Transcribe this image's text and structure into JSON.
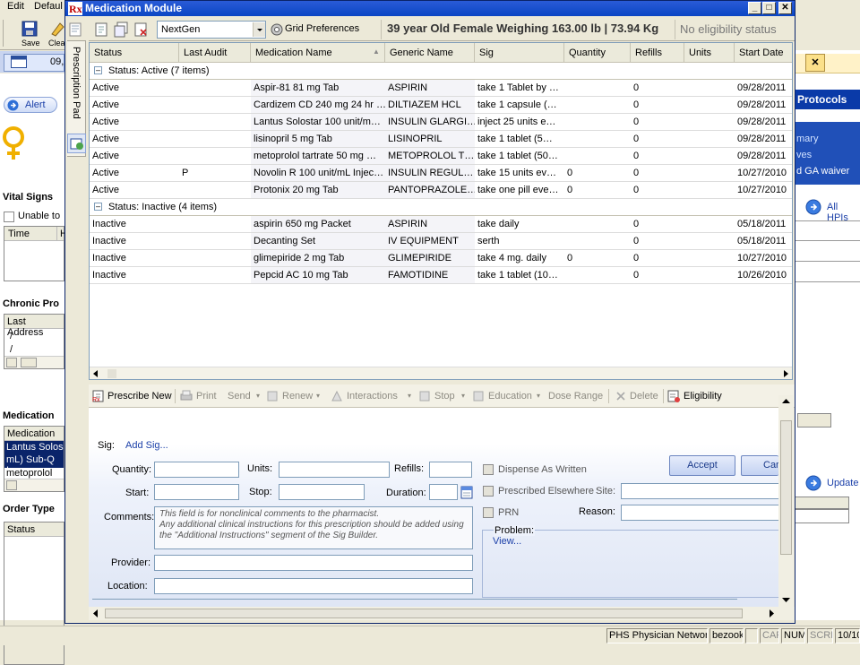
{
  "background_app": {
    "menu": [
      "Edit",
      "Defaul"
    ],
    "toolbar": {
      "save_label": "Save",
      "clear_label": "Clea"
    },
    "tab_fragment": "09,",
    "alert_button": "Alert",
    "vital_signs_label": "Vital Signs",
    "unable_label": "Unable to",
    "vitals_columns": [
      "Time",
      "H"
    ],
    "chronic_label": "Chronic Pro",
    "last_address_label": "Last Address",
    "slash_rows": [
      " / ",
      " / "
    ],
    "medication_label": "Medication",
    "medication_col": "Medication",
    "medication_rows": [
      "Lantus Solos",
      "mL) Sub-Q In",
      "metoprolol tar"
    ],
    "order_type_label": "Order Type",
    "order_status_col": "Status",
    "right_close": "✕",
    "right_protocols": "Protocols",
    "right_link1": "mary",
    "right_link2": "ves",
    "right_link3": "d GA waiver",
    "all_hpis_label": "All HPIs",
    "update_label": "Update"
  },
  "window": {
    "title": "Medication Module",
    "min_glyph": "_",
    "max_glyph": "□",
    "close_glyph": "✕"
  },
  "side_tab": {
    "label": "Prescription Pad"
  },
  "toolbar": {
    "source_select": "NextGen",
    "grid_preferences_label": "Grid Preferences",
    "patient_info": "39 year Old Female Weighing 163.00 lb  | 73.94 Kg",
    "eligibility_status": "No eligibility status"
  },
  "grid": {
    "columns": [
      "Status",
      "Last Audit",
      "Medication Name",
      "Generic Name",
      "Sig",
      "Quantity",
      "Refills",
      "Units",
      "Start Date"
    ],
    "sort_indicator": "▲",
    "groups": [
      {
        "label": "Status: Active (7 items)",
        "rows": [
          [
            "Active",
            "",
            "Aspir-81 81 mg Tab",
            "ASPIRIN",
            "take 1 Tablet by …",
            "",
            "0",
            "",
            "09/28/2011"
          ],
          [
            "Active",
            "",
            "Cardizem CD 240 mg 24 hr …",
            "DILTIAZEM HCL",
            "take 1 capsule (…",
            "",
            "0",
            "",
            "09/28/2011"
          ],
          [
            "Active",
            "",
            "Lantus Solostar 100 unit/m…",
            "INSULIN GLARGI…",
            "inject 25 units e…",
            "",
            "0",
            "",
            "09/28/2011"
          ],
          [
            "Active",
            "",
            "lisinopril 5 mg Tab",
            "LISINOPRIL",
            "take 1 tablet (5…",
            "",
            "0",
            "",
            "09/28/2011"
          ],
          [
            "Active",
            "",
            "metoprolol tartrate 50 mg …",
            "METOPROLOL T…",
            "take 1 tablet (50…",
            "",
            "0",
            "",
            "09/28/2011"
          ],
          [
            "Active",
            "P",
            "Novolin R 100 unit/mL Injec…",
            "INSULIN REGUL…",
            "take 15 units ev…",
            "0",
            "0",
            "",
            "10/27/2010"
          ],
          [
            "Active",
            "",
            "Protonix 20 mg Tab",
            "PANTOPRAZOLE…",
            "take one pill eve…",
            "0",
            "0",
            "",
            "10/27/2010"
          ]
        ]
      },
      {
        "label": "Status: Inactive (4 items)",
        "rows": [
          [
            "Inactive",
            "",
            "aspirin 650 mg Packet",
            "ASPIRIN",
            "take daily",
            "",
            "0",
            "",
            "05/18/2011"
          ],
          [
            "Inactive",
            "",
            "Decanting Set",
            "IV EQUIPMENT",
            "serth",
            "",
            "0",
            "",
            "05/18/2011"
          ],
          [
            "Inactive",
            "",
            "glimepiride 2 mg Tab",
            "GLIMEPIRIDE",
            "take 4 mg. daily",
            "0",
            "0",
            "",
            "10/27/2010"
          ],
          [
            "Inactive",
            "",
            "Pepcid AC 10 mg Tab",
            "FAMOTIDINE",
            "take 1 tablet (10…",
            "",
            "0",
            "",
            "10/26/2010"
          ]
        ]
      }
    ]
  },
  "rx_toolbar": {
    "prescribe_new": "Prescribe New",
    "print": "Print",
    "send": "Send",
    "renew": "Renew",
    "interactions": "Interactions",
    "stop": "Stop",
    "education": "Education",
    "dose_range": "Dose Range",
    "delete": "Delete",
    "eligibility": "Eligibility"
  },
  "rx_form": {
    "sig_label": "Sig:",
    "add_sig_link": "Add Sig...",
    "quantity_label": "Quantity:",
    "units_label": "Units:",
    "refills_label": "Refills:",
    "start_label": "Start:",
    "stop_label": "Stop:",
    "duration_label": "Duration:",
    "comments_label": "Comments:",
    "comments_placeholder": "This field is for nonclinical comments to the pharmacist.\nAny additional clinical instructions for this prescription should be added using the \"Additional Instructions\" segment of the Sig Builder.",
    "provider_label": "Provider:",
    "location_label": "Location:",
    "dispense_as_written": "Dispense As Written",
    "prescribed_elsewhere": "Prescribed Elsewhere",
    "site_label": "Site:",
    "prn_label": "PRN",
    "reason_label": "Reason:",
    "problem_label": "Problem:",
    "view_link": "View...",
    "accept_button": "Accept",
    "cancel_button": "Car"
  },
  "status_bar": {
    "network": "PHS Physician Network",
    "user": "bezook",
    "cap": "CAP",
    "num": "NUM",
    "scrl": "SCRL",
    "date": "10/10"
  },
  "colors": {
    "title_bar": "#0a46c4",
    "grid_border": "#7f9db9",
    "link_blue": "#1a3fa8",
    "selected_row": "#0a246a"
  }
}
